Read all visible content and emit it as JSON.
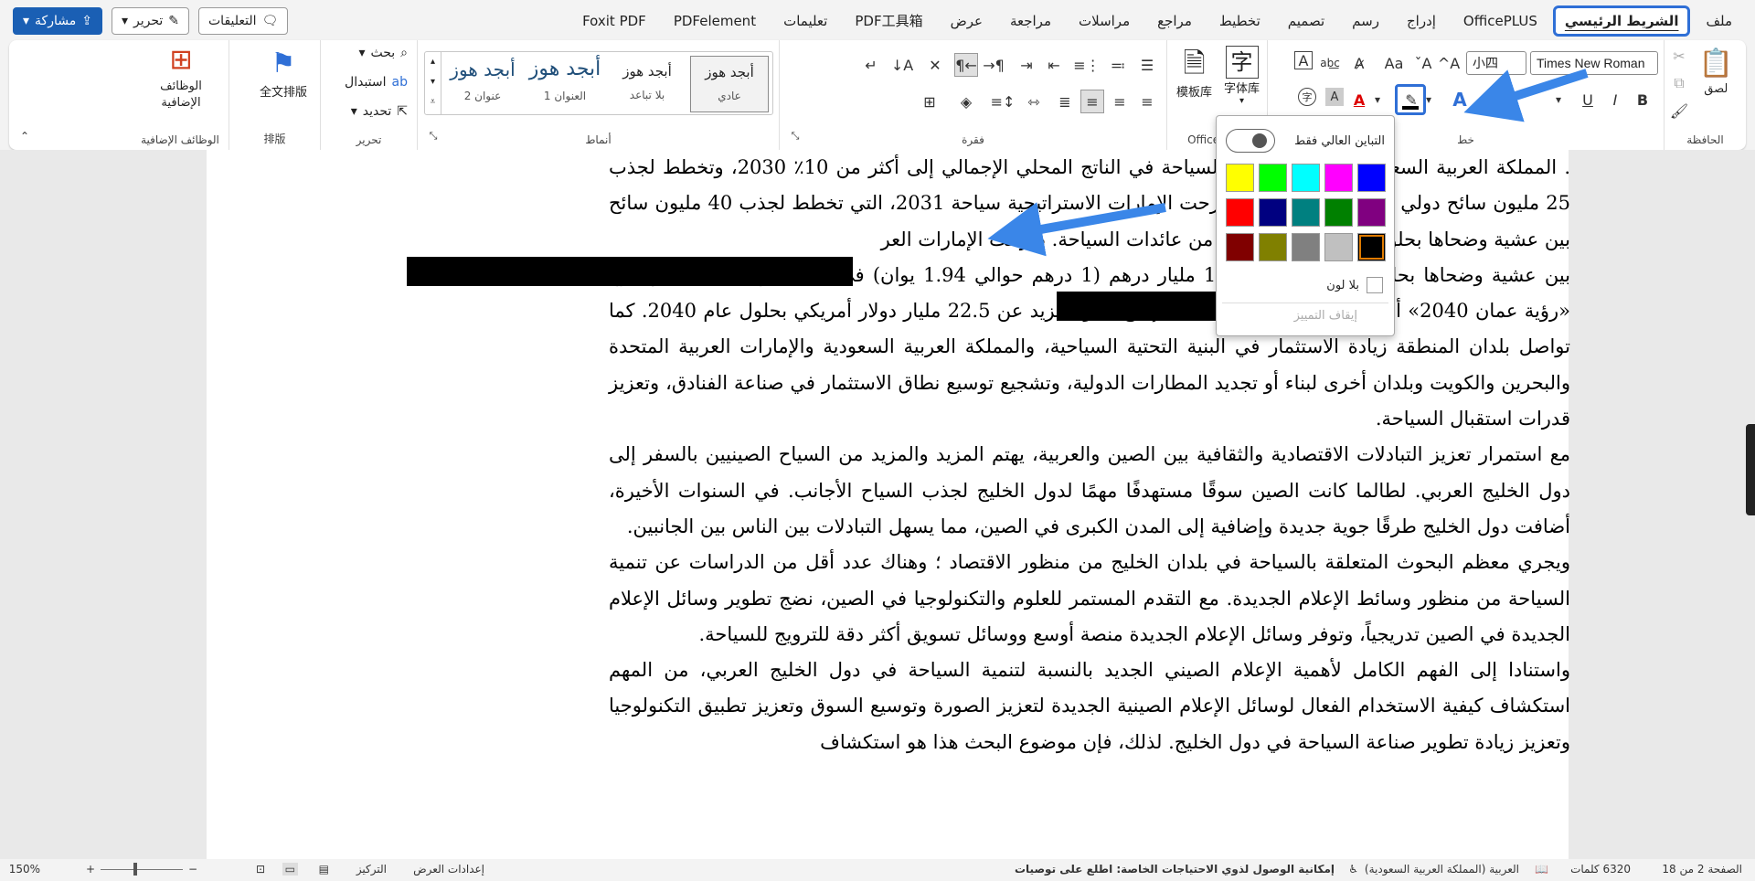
{
  "tabs": [
    "ملف",
    "الشريط الرئيسي",
    "OfficePLUS",
    "إدراج",
    "رسم",
    "تصميم",
    "تخطيط",
    "مراجع",
    "مراسلات",
    "مراجعة",
    "عرض",
    "PDF工具箱",
    "تعليمات",
    "PDFelement",
    "Foxit PDF"
  ],
  "active_tab": "الشريط الرئيسي",
  "top_buttons": {
    "comments": "التعليقات",
    "edit": "تحرير",
    "share": "مشاركة"
  },
  "ribbon": {
    "clipboard": {
      "label": "الحافظة",
      "paste": "لصق"
    },
    "font": {
      "label": "خط",
      "name": "Times New Roman",
      "size": "小四",
      "bold": "B",
      "italic": "I",
      "underline": "U",
      "superscript": "x²",
      "grow": "A^",
      "shrink": "Aˇ",
      "case": "Aa",
      "clear": "A"
    },
    "officeplus": {
      "label": "OfficePLUS",
      "font_lib": "字体库",
      "template_lib": "模板库"
    },
    "paragraph": {
      "label": "فقرة"
    },
    "styles": {
      "label": "أنماط",
      "items": [
        {
          "preview": "أبجد هوز",
          "name": "عادي"
        },
        {
          "preview": "أبجد هوز",
          "name": "بلا تباعد"
        },
        {
          "preview": "أبجد هوز",
          "name": "العنوان 1"
        },
        {
          "preview": "أبجد هوز",
          "name": "عنوان 2"
        }
      ]
    },
    "editing": {
      "label": "تحرير",
      "find": "بحث",
      "replace": "استبدال",
      "select": "تحديد"
    },
    "layout": {
      "label": "排版",
      "full_text": "全文排版"
    },
    "addins": {
      "label": "الوظائف الإضافية",
      "button": "الوظائف الإضافية"
    }
  },
  "highlight_menu": {
    "high_contrast": "التباين العالي فقط",
    "colors": [
      "#ffff00",
      "#00ff00",
      "#00ffff",
      "#ff00ff",
      "#0000ff",
      "#ff0000",
      "#000080",
      "#008080",
      "#008000",
      "#800080",
      "#800000",
      "#808000",
      "#808080",
      "#c0c0c0",
      "#000000"
    ],
    "selected_color": "#000000",
    "no_color": "بلا لون",
    "stop": "إيقاف التمييز"
  },
  "document": {
    "paragraphs": [
      ". المملكة العربية السعودية لزيادة مساهمة السياحة في الناتج المحلي الإجمالي إلى أكثر من 10٪ 2030، وتخطط لجذب 25 مليون سائح دولي بحلول عام 2023 ؛ طرحت الإمارات الاستراتيجية سياحة 2031، التي تخطط لجذب 40 مليون سائح بين عشية وضحاها بحلول عام 2031، و 100 من عائدات السياحة. طرحت الإمارات العر",
      "بين عشية وضحاها بحلول عام 2031، و 100 مليار درهم (1 درهم حوالي 1.94 يوان) في الاستثمار السياحي ؛ وتقترح «رؤية عمان 2040» أن تحقق صناعة السياحة قيمة إنتاج سنوية تزيد عن 22.5 مليار دولار أمريكي بحلول عام 2040. كما تواصل بلدان المنطقة زيادة الاستثمار في البنية التحتية السياحية، والمملكة العربية السعودية والإمارات العربية المتحدة والبحرين والكويت وبلدان أخرى لبناء أو تجديد المطارات الدولية، وتشجيع توسيع نطاق الاستثمار في صناعة الفنادق، وتعزيز قدرات استقبال السياحة.",
      "مع استمرار تعزيز التبادلات الاقتصادية والثقافية بين الصين والعربية، يهتم المزيد والمزيد من السياح الصينيين بالسفر إلى دول الخليج العربي. لطالما كانت الصين سوقًا مستهدفًا مهمًا لدول الخليج لجذب السياح الأجانب. في السنوات الأخيرة، أضافت دول الخليج طرقًا جوية جديدة وإضافية إلى المدن الكبرى في الصين، مما يسهل التبادلات بين الناس بين الجانبين.",
      "ويجري معظم البحوث المتعلقة بالسياحة في بلدان الخليج من منظور الاقتصاد ؛ وهناك عدد أقل من الدراسات عن تنمية السياحة من منظور وسائط الإعلام الجديدة. مع التقدم المستمر للعلوم والتكنولوجيا في الصين، نضج تطوير وسائل الإعلام الجديدة في الصين تدريجياً، وتوفر وسائل الإعلام الجديدة منصة أوسع ووسائل تسويق أكثر دقة للترويج للسياحة.",
      "واستنادا إلى الفهم الكامل لأهمية الإعلام الصيني الجديد بالنسبة لتنمية السياحة في دول الخليج العربي، من المهم استكشاف كيفية الاستخدام الفعال لوسائل الإعلام الصينية الجديدة لتعزيز الصورة وتوسيع السوق وتعزيز تطبيق التكنولوجيا وتعزيز زيادة تطوير صناعة السياحة في دول الخليج. لذلك، فإن موضوع البحث هذا هو استكشاف"
    ]
  },
  "status": {
    "page": "الصفحة 2 من 18",
    "words": "6320 كلمات",
    "language": "العربية (المملكة العربية السعودية)",
    "accessibility": "إمكانية الوصول لذوي الاحتياجات الخاصة: اطلع على توصيات",
    "display_settings": "إعدادات العرض",
    "focus": "التركيز",
    "zoom": "150%"
  }
}
